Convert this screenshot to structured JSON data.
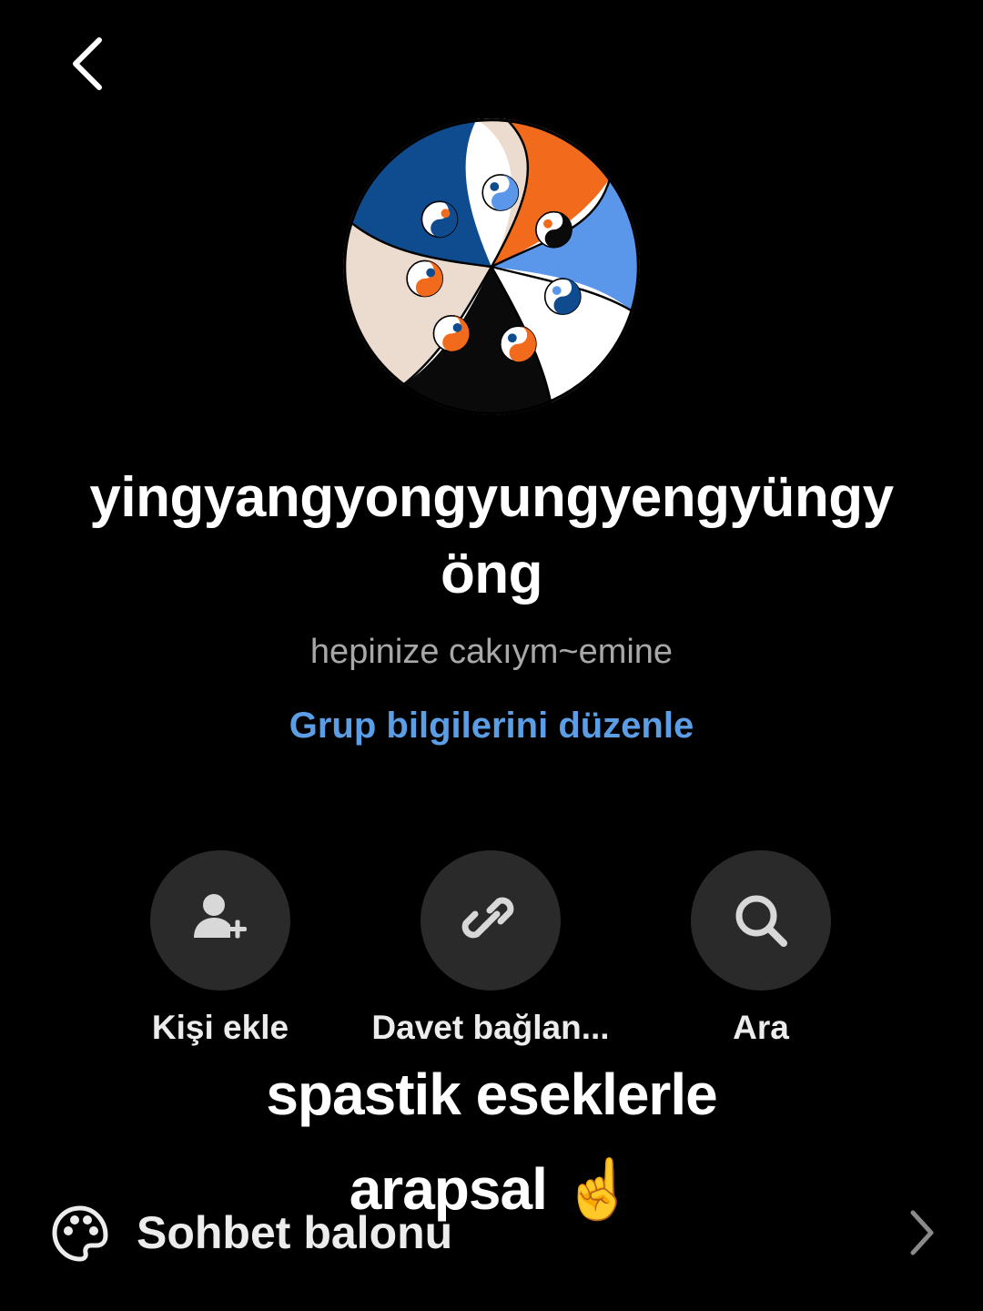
{
  "header": {
    "back_icon": "chevron-left-icon"
  },
  "group": {
    "name": "yingyangyongyungyengyüngyöng",
    "description": "hepinize cakıym~emine",
    "edit_link": "Grup bilgilerini düzenle"
  },
  "actions": [
    {
      "label": "Kişi ekle",
      "icon": "add-person-icon"
    },
    {
      "label": "Davet bağlan...",
      "icon": "link-icon"
    },
    {
      "label": "Ara",
      "icon": "search-icon"
    }
  ],
  "overlay": {
    "caption_line1": "spastik eseklerle",
    "caption_line2": "arapsal ☝️"
  },
  "settings": {
    "chat_bubble_label": "Sohbet balonu",
    "chat_bubble_icon": "palette-icon"
  },
  "colors": {
    "background": "#000000",
    "accent_link": "#5b9ee6",
    "action_circle": "#2a2a2a",
    "avatar_orange": "#f26a1b",
    "avatar_navy": "#0f4c8f",
    "avatar_sky": "#5a97ea",
    "avatar_cream": "#ecdccf"
  }
}
